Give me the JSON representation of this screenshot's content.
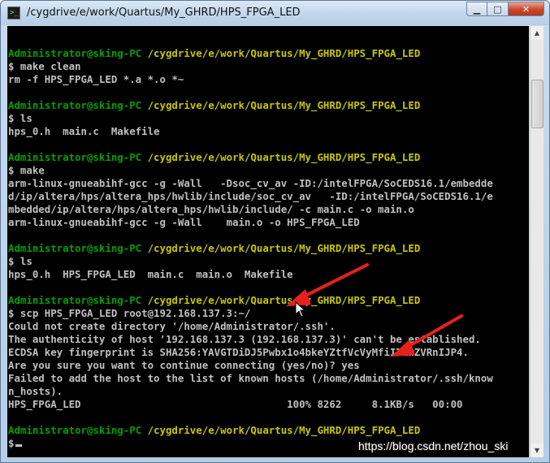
{
  "window": {
    "title": "/cygdrive/e/work/Quartus/My_GHRD/HPS_FPGA_LED",
    "minimize_label": "▁",
    "maximize_label": "□",
    "close_label": "✕"
  },
  "terminal": {
    "lines": [
      {
        "type": "blank",
        "text": ""
      },
      {
        "type": "prompt",
        "user": "Administrator@sking-PC",
        "path": "/cygdrive/e/work/Quartus/My_GHRD/HPS_FPGA_LED"
      },
      {
        "type": "out",
        "text": "$ make clean"
      },
      {
        "type": "out",
        "text": "rm -f HPS_FPGA_LED *.a *.o *~"
      },
      {
        "type": "blank",
        "text": ""
      },
      {
        "type": "prompt",
        "user": "Administrator@sking-PC",
        "path": "/cygdrive/e/work/Quartus/My_GHRD/HPS_FPGA_LED"
      },
      {
        "type": "out",
        "text": "$ ls"
      },
      {
        "type": "out",
        "text": "hps_0.h  main.c  Makefile"
      },
      {
        "type": "blank",
        "text": ""
      },
      {
        "type": "prompt",
        "user": "Administrator@sking-PC",
        "path": "/cygdrive/e/work/Quartus/My_GHRD/HPS_FPGA_LED"
      },
      {
        "type": "out",
        "text": "$ make"
      },
      {
        "type": "out",
        "text": "arm-linux-gnueabihf-gcc -g -Wall   -Dsoc_cv_av -ID:/intelFPGA/SoCEDS16.1/embedde"
      },
      {
        "type": "out",
        "text": "d/ip/altera/hps/altera_hps/hwlib/include/soc_cv_av   -ID:/intelFPGA/SoCEDS16.1/e"
      },
      {
        "type": "out",
        "text": "mbedded/ip/altera/hps/altera_hps/hwlib/include/ -c main.c -o main.o"
      },
      {
        "type": "out",
        "text": "arm-linux-gnueabihf-gcc -g -Wall    main.o -o HPS_FPGA_LED"
      },
      {
        "type": "blank",
        "text": ""
      },
      {
        "type": "prompt",
        "user": "Administrator@sking-PC",
        "path": "/cygdrive/e/work/Quartus/My_GHRD/HPS_FPGA_LED"
      },
      {
        "type": "out",
        "text": "$ ls"
      },
      {
        "type": "out",
        "text": "hps_0.h  HPS_FPGA_LED  main.c  main.o  Makefile"
      },
      {
        "type": "blank",
        "text": ""
      },
      {
        "type": "prompt",
        "user": "Administrator@sking-PC",
        "path": "/cygdrive/e/work/Quartus/My_GHRD/HPS_FPGA_LED"
      },
      {
        "type": "out",
        "text": "$ scp HPS_FPGA_LED root@192.168.137.3:~/"
      },
      {
        "type": "out",
        "text": "Could not create directory '/home/Administrator/.ssh'."
      },
      {
        "type": "out",
        "text": "The authenticity of host '192.168.137.3 (192.168.137.3)' can't be established."
      },
      {
        "type": "out",
        "text": "ECDSA key fingerprint is SHA256:YAVGTDiDJ5Pwbx1o4bkeYZtfVcVyMfiITZwZVRnIJP4."
      },
      {
        "type": "out",
        "text": "Are you sure you want to continue connecting (yes/no)? yes"
      },
      {
        "type": "out",
        "text": "Failed to add the host to the list of known hosts (/home/Administrator/.ssh/know"
      },
      {
        "type": "out",
        "text": "n_hosts)."
      },
      {
        "type": "out",
        "text": "HPS_FPGA_LED                                  100% 8262     8.1KB/s   00:00"
      },
      {
        "type": "blank",
        "text": ""
      },
      {
        "type": "prompt",
        "user": "Administrator@sking-PC",
        "path": "/cygdrive/e/work/Quartus/My_GHRD/HPS_FPGA_LED"
      },
      {
        "type": "cursor",
        "text": "$"
      }
    ]
  },
  "watermark": "https://blog.csdn.net/zhou_ski",
  "colors": {
    "background": "#000000",
    "text": "#c0c0c0",
    "prompt_user": "#00a000",
    "prompt_path": "#c8c800",
    "annotation_arrow": "#e8201c"
  },
  "icons": [
    "terminal-icon",
    "minimize-icon",
    "maximize-icon",
    "close-icon",
    "scroll-up-icon",
    "scroll-down-icon",
    "mouse-pointer-icon",
    "red-arrow-icon"
  ]
}
